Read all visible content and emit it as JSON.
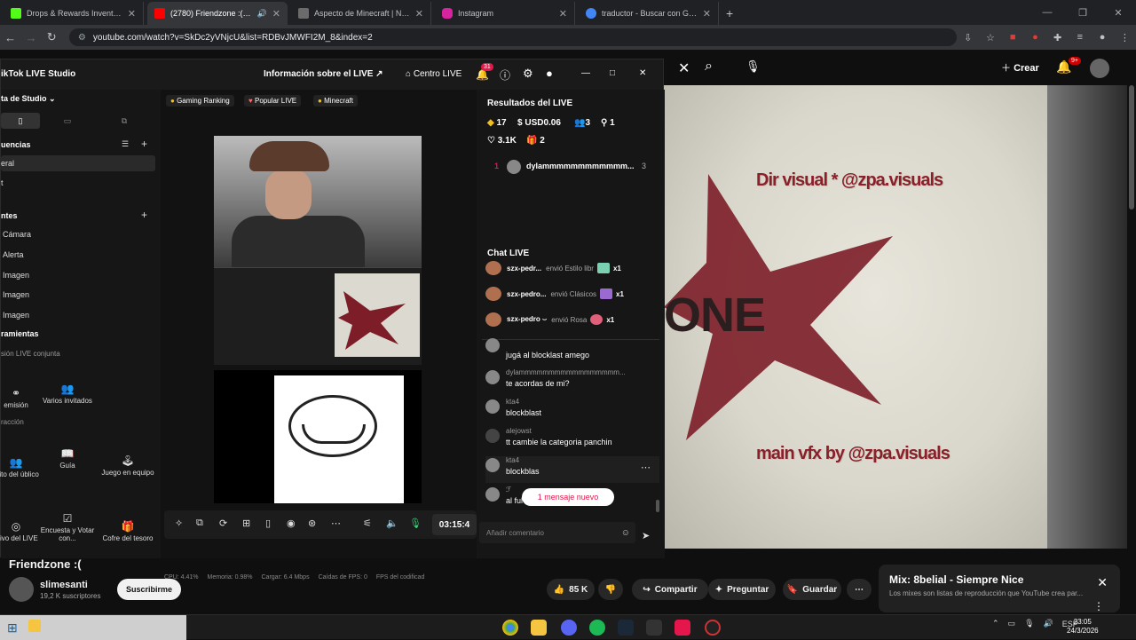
{
  "browser": {
    "tabs": [
      {
        "title": "Drops & Rewards Inventory - K",
        "color": "#53fc18"
      },
      {
        "title": "(2780) Friendzone :( - YouTu",
        "color": "#ff0000",
        "active": true
      },
      {
        "title": "Aspecto de Minecraft | NameM",
        "color": "#6b6b6b"
      },
      {
        "title": "Instagram",
        "color": "#d6249f"
      },
      {
        "title": "traductor - Buscar con Google",
        "color": "#4285f4"
      }
    ],
    "url": "youtube.com/watch?v=SkDc2yVNjcU&list=RDBvJMWFI2M_8&index=2"
  },
  "youtube": {
    "create_label": "Crear",
    "notif_count": "9+",
    "video_overlay": {
      "line1": "Dir visual * @zpa.visuals",
      "line2": "main vfx by @zpa.visuals",
      "logo": "ONE"
    },
    "title": "Friendzone :(",
    "channel": "slimesanti",
    "subscribers": "19,2 K suscriptores",
    "subscribe_label": "Suscribirme",
    "likes": "85 K",
    "share_label": "Compartir",
    "ask_label": "Preguntar",
    "save_label": "Guardar",
    "mix": {
      "title": "Mix: 8belial - Siempre Nice",
      "desc": "Los mixes son listas de reproducción que YouTube crea par..."
    }
  },
  "tiktok": {
    "app_title": "ikTok LIVE Studio",
    "live_info": "Información sobre el LIVE",
    "centro": "Centro LIVE",
    "notif_count": "31",
    "sidebar": {
      "studio_dropdown": "ta de Studio",
      "secuencias": "uencias",
      "general": "eral",
      "item_t": "t",
      "fuentes": "ntes",
      "sources": [
        "Cámara",
        "Alerta",
        "Imagen",
        "Imagen",
        "Imagen"
      ],
      "herramientas": "ramientas",
      "live_conjunta": "sión LIVE conjunta",
      "btn_emision": "emisión",
      "btn_invitados": "Varios invitados",
      "interaccion": "racción",
      "btn_favorito": "orito del úblico",
      "btn_guia": "Guía",
      "btn_juego": "Juego en equipo",
      "btn_objetivo": "etivo del LIVE",
      "btn_encuesta": "Encuesta y Votar con...",
      "btn_cofre": "Cofre del tesoro"
    },
    "tags": [
      "Gaming Ranking",
      "Popular LIVE",
      "Minecraft"
    ],
    "timer": "03:15:4",
    "stats": [
      "CPU: 4.41%",
      "Memoria: 0.98%",
      "Cargar: 6.4 Mbps",
      "Caídas de FPS: 0",
      "FPS del codificad"
    ],
    "results": {
      "title": "Resultados del LIVE",
      "diamonds": "17",
      "usd": "USD0.06",
      "viewers": "3",
      "new_followers": "1",
      "likes": "3.1K",
      "gifts": "2",
      "rank_pos": "1",
      "rank_user": "dylammmmmmmmmmmm...",
      "rank_count": "3"
    },
    "chat": {
      "title": "Chat LIVE",
      "gifts": [
        {
          "user": "szx-pedr...",
          "action": "envió Estilo libr",
          "count": "x1",
          "color": "#7ad0b0"
        },
        {
          "user": "szx-pedro...",
          "action": "envió Clásicos",
          "count": "x1",
          "color": "#9a6ad0"
        },
        {
          "user": "szx-pedro ⌣",
          "action": "envió Rosa",
          "count": "x1",
          "color": "#e0607a"
        }
      ],
      "messages": [
        {
          "user": "",
          "text": "jugá al blocklast amego"
        },
        {
          "user": "dylammmmmmmmmmmmmmmmm...",
          "text": "te acordas de mi?"
        },
        {
          "user": "kta4",
          "text": "blockblast"
        },
        {
          "user": "alejowst",
          "text": "tt cambie la categoria panchin"
        },
        {
          "user": "kta4",
          "text": "blockblas"
        },
        {
          "user": "ℱ",
          "text": "al ful"
        }
      ],
      "new_message": "1 mensaje nuevo",
      "comment_placeholder": "Añadir comentario"
    }
  },
  "taskbar": {
    "lang": "ESP",
    "time": "23:05",
    "date": "24/3/2026"
  }
}
